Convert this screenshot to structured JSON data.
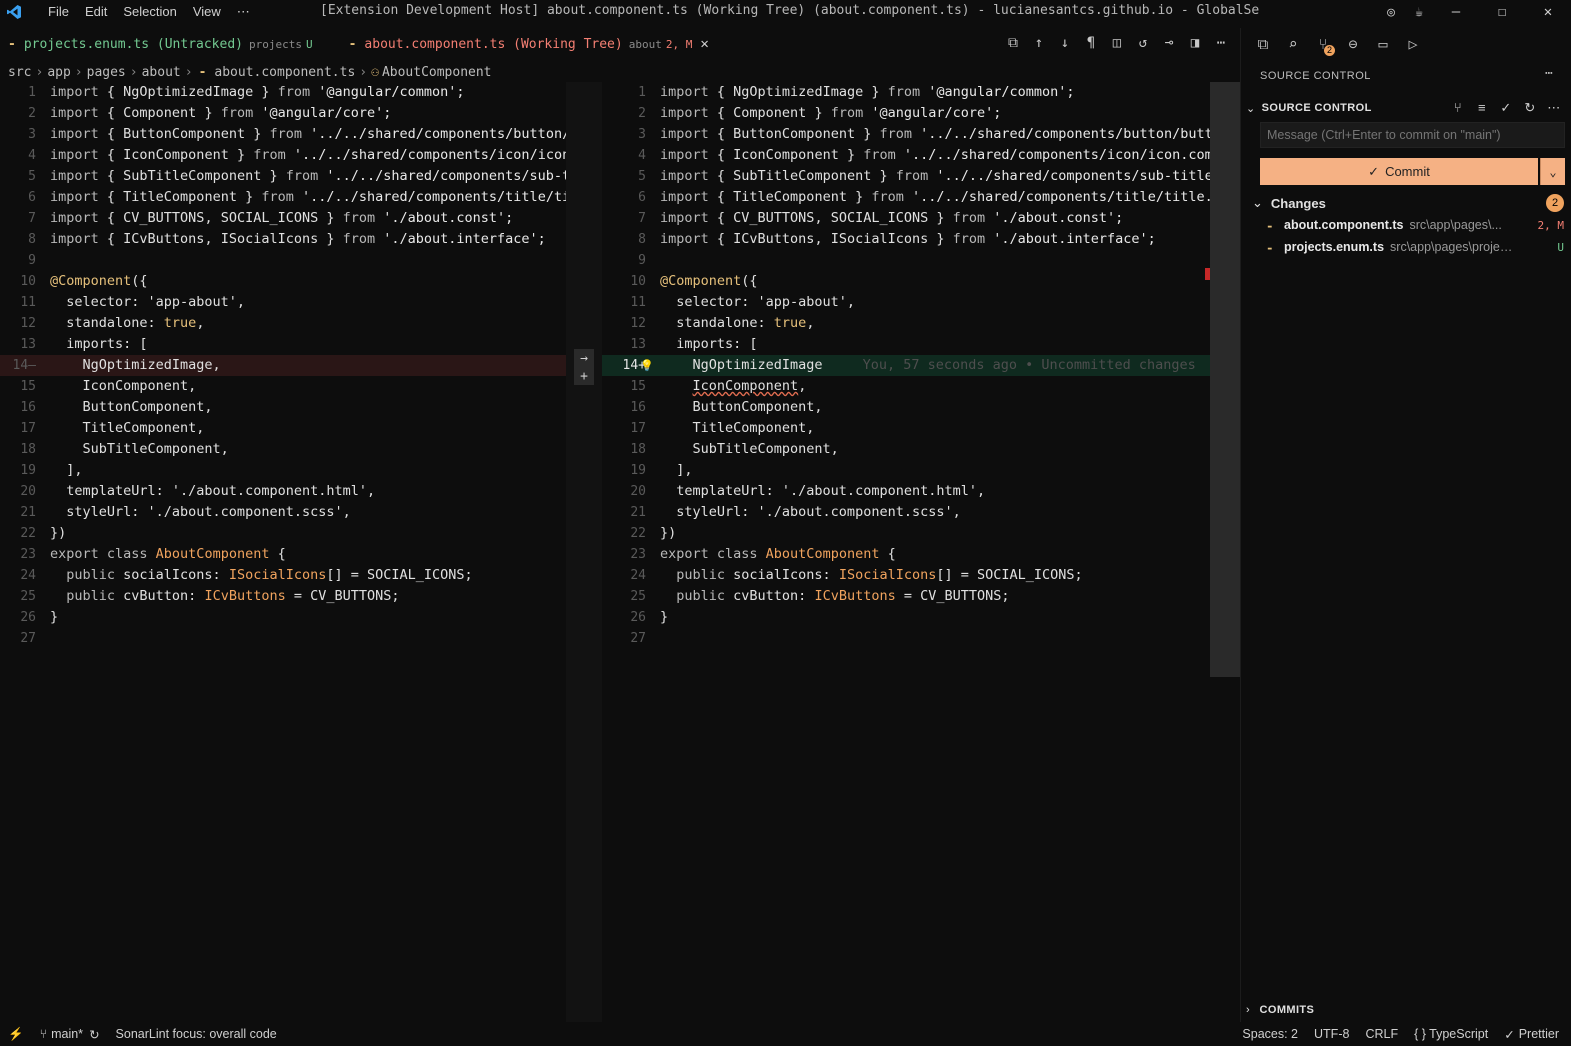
{
  "titlebar": {
    "menu": [
      "File",
      "Edit",
      "Selection",
      "View",
      "⋯"
    ],
    "title": "[Extension Development Host] about.component.ts (Working Tree) (about.component.ts) - lucianesantcs.github.io - GlobalSettings - …"
  },
  "tabs": {
    "projects": {
      "name": "projects.enum.ts (Untracked)",
      "folder": "projects",
      "status": "U"
    },
    "about": {
      "name": "about.component.ts (Working Tree)",
      "folder": "about",
      "status": "2, M"
    }
  },
  "breadcrumb": [
    "src",
    "app",
    "pages",
    "about",
    "about.component.ts",
    "AboutComponent"
  ],
  "editor_left": {
    "lines": [
      {
        "n": "1",
        "segs": [
          [
            "kw",
            "import"
          ],
          [
            "",
            "{ NgOptimizedImage } "
          ],
          [
            "kw",
            "from"
          ],
          [
            "str",
            " '@angular/common';"
          ]
        ]
      },
      {
        "n": "2",
        "segs": [
          [
            "kw",
            "import"
          ],
          [
            "",
            "{ Component } "
          ],
          [
            "kw",
            "from"
          ],
          [
            "str",
            " '@angular/core';"
          ]
        ]
      },
      {
        "n": "3",
        "segs": [
          [
            "kw",
            "import"
          ],
          [
            "",
            "{ ButtonComponent } "
          ],
          [
            "kw",
            "from"
          ],
          [
            "str",
            " '../../shared/components/button/bu"
          ]
        ]
      },
      {
        "n": "4",
        "segs": [
          [
            "kw",
            "import"
          ],
          [
            "",
            "{ IconComponent } "
          ],
          [
            "kw",
            "from"
          ],
          [
            "str",
            " '../../shared/components/icon/icon.c"
          ]
        ]
      },
      {
        "n": "5",
        "segs": [
          [
            "kw",
            "import"
          ],
          [
            "",
            "{ SubTitleComponent } "
          ],
          [
            "kw",
            "from"
          ],
          [
            "str",
            " '../../shared/components/sub-tit"
          ]
        ]
      },
      {
        "n": "6",
        "segs": [
          [
            "kw",
            "import"
          ],
          [
            "",
            "{ TitleComponent } "
          ],
          [
            "kw",
            "from"
          ],
          [
            "str",
            " '../../shared/components/title/titl"
          ]
        ]
      },
      {
        "n": "7",
        "segs": [
          [
            "kw",
            "import"
          ],
          [
            "",
            "{ CV_BUTTONS, SOCIAL_ICONS } "
          ],
          [
            "kw",
            "from"
          ],
          [
            "str",
            " './about.const';"
          ]
        ]
      },
      {
        "n": "8",
        "segs": [
          [
            "kw",
            "import"
          ],
          [
            "",
            "{ ICvButtons, ISocialIcons } "
          ],
          [
            "kw",
            "from"
          ],
          [
            "str",
            " './about.interface';"
          ]
        ]
      },
      {
        "n": "9",
        "segs": []
      },
      {
        "n": "10",
        "segs": [
          [
            "dec",
            "@Component"
          ],
          [
            "",
            "({"
          ]
        ]
      },
      {
        "n": "11",
        "segs": [
          [
            "",
            "  selector: 'app-about',"
          ]
        ]
      },
      {
        "n": "12",
        "segs": [
          [
            "",
            "  standalone: "
          ],
          [
            "bool",
            "true"
          ],
          [
            "",
            ","
          ]
        ]
      },
      {
        "n": "13",
        "segs": [
          [
            "",
            "  imports: ["
          ]
        ]
      },
      {
        "n": "14—",
        "segs": [
          [
            "",
            "    NgOptimizedImage,"
          ]
        ],
        "cls": "line-del"
      },
      {
        "n": "15",
        "segs": [
          [
            "",
            "    IconComponent,"
          ]
        ]
      },
      {
        "n": "16",
        "segs": [
          [
            "",
            "    ButtonComponent,"
          ]
        ]
      },
      {
        "n": "17",
        "segs": [
          [
            "",
            "    TitleComponent,"
          ]
        ]
      },
      {
        "n": "18",
        "segs": [
          [
            "",
            "    SubTitleComponent,"
          ]
        ]
      },
      {
        "n": "19",
        "segs": [
          [
            "",
            "  ],"
          ]
        ]
      },
      {
        "n": "20",
        "segs": [
          [
            "",
            "  templateUrl: './about.component.html',"
          ]
        ]
      },
      {
        "n": "21",
        "segs": [
          [
            "",
            "  styleUrl: './about.component.scss',"
          ]
        ]
      },
      {
        "n": "22",
        "segs": [
          [
            "",
            "})"
          ]
        ]
      },
      {
        "n": "23",
        "segs": [
          [
            "kw",
            "export class "
          ],
          [
            "cls",
            "AboutComponent"
          ],
          [
            "",
            " {"
          ]
        ]
      },
      {
        "n": "24",
        "segs": [
          [
            "kw",
            "  public "
          ],
          [
            "",
            "socialIcons: "
          ],
          [
            "cls",
            "ISocialIcons"
          ],
          [
            "",
            "[] = SOCIAL_ICONS;"
          ]
        ]
      },
      {
        "n": "25",
        "segs": [
          [
            "kw",
            "  public "
          ],
          [
            "",
            "cvButton: "
          ],
          [
            "cls",
            "ICvButtons"
          ],
          [
            "",
            " = CV_BUTTONS;"
          ]
        ]
      },
      {
        "n": "26",
        "segs": [
          [
            "",
            "}"
          ]
        ]
      },
      {
        "n": "27",
        "segs": []
      }
    ]
  },
  "editor_right": {
    "blame": "You, 57 seconds ago • Uncommitted changes",
    "lines": [
      {
        "n": "1",
        "segs": [
          [
            "kw",
            "import"
          ],
          [
            "",
            "{ NgOptimizedImage } "
          ],
          [
            "kw",
            "from"
          ],
          [
            "str",
            " '@angular/common';"
          ]
        ]
      },
      {
        "n": "2",
        "segs": [
          [
            "kw",
            "import"
          ],
          [
            "",
            "{ Component } "
          ],
          [
            "kw",
            "from"
          ],
          [
            "str",
            " '@angular/core';"
          ]
        ]
      },
      {
        "n": "3",
        "segs": [
          [
            "kw",
            "import"
          ],
          [
            "",
            "{ ButtonComponent } "
          ],
          [
            "kw",
            "from"
          ],
          [
            "str",
            " '../../shared/components/button/button."
          ]
        ]
      },
      {
        "n": "4",
        "segs": [
          [
            "kw",
            "import"
          ],
          [
            "",
            "{ IconComponent } "
          ],
          [
            "kw",
            "from"
          ],
          [
            "str",
            " '../../shared/components/icon/icon.compon"
          ]
        ]
      },
      {
        "n": "5",
        "segs": [
          [
            "kw",
            "import"
          ],
          [
            "",
            "{ SubTitleComponent } "
          ],
          [
            "kw",
            "from"
          ],
          [
            "str",
            " '../../shared/components/sub-title/su"
          ]
        ]
      },
      {
        "n": "6",
        "segs": [
          [
            "kw",
            "import"
          ],
          [
            "",
            "{ TitleComponent } "
          ],
          [
            "kw",
            "from"
          ],
          [
            "str",
            " '../../shared/components/title/title.com"
          ]
        ]
      },
      {
        "n": "7",
        "segs": [
          [
            "kw",
            "import"
          ],
          [
            "",
            "{ CV_BUTTONS, SOCIAL_ICONS } "
          ],
          [
            "kw",
            "from"
          ],
          [
            "str",
            " './about.const';"
          ]
        ]
      },
      {
        "n": "8",
        "segs": [
          [
            "kw",
            "import"
          ],
          [
            "",
            "{ ICvButtons, ISocialIcons } "
          ],
          [
            "kw",
            "from"
          ],
          [
            "str",
            " './about.interface';"
          ]
        ]
      },
      {
        "n": "9",
        "segs": []
      },
      {
        "n": "10",
        "segs": [
          [
            "dec",
            "@Component"
          ],
          [
            "",
            "({"
          ]
        ]
      },
      {
        "n": "11",
        "segs": [
          [
            "",
            "  selector: 'app-about',"
          ]
        ]
      },
      {
        "n": "12",
        "segs": [
          [
            "",
            "  standalone: "
          ],
          [
            "bool",
            "true"
          ],
          [
            "",
            ","
          ]
        ]
      },
      {
        "n": "13",
        "segs": [
          [
            "",
            "  imports: ["
          ]
        ]
      },
      {
        "n": "14+",
        "segs": [
          [
            "",
            "    NgOptimizedImage"
          ]
        ],
        "cls": "line-add line-active",
        "blame": true
      },
      {
        "n": "15",
        "segs": [
          [
            "",
            "    "
          ],
          [
            "squiggle",
            "IconComponent"
          ],
          [
            "",
            ","
          ]
        ]
      },
      {
        "n": "16",
        "segs": [
          [
            "",
            "    ButtonComponent,"
          ]
        ]
      },
      {
        "n": "17",
        "segs": [
          [
            "",
            "    TitleComponent,"
          ]
        ]
      },
      {
        "n": "18",
        "segs": [
          [
            "",
            "    SubTitleComponent,"
          ]
        ]
      },
      {
        "n": "19",
        "segs": [
          [
            "",
            "  ],"
          ]
        ]
      },
      {
        "n": "20",
        "segs": [
          [
            "",
            "  templateUrl: './about.component.html',"
          ]
        ]
      },
      {
        "n": "21",
        "segs": [
          [
            "",
            "  styleUrl: './about.component.scss',"
          ]
        ]
      },
      {
        "n": "22",
        "segs": [
          [
            "",
            "})"
          ]
        ]
      },
      {
        "n": "23",
        "segs": [
          [
            "kw",
            "export class "
          ],
          [
            "cls",
            "AboutComponent"
          ],
          [
            "",
            " {"
          ]
        ]
      },
      {
        "n": "24",
        "segs": [
          [
            "kw",
            "  public "
          ],
          [
            "",
            "socialIcons: "
          ],
          [
            "cls",
            "ISocialIcons"
          ],
          [
            "",
            "[] = SOCIAL_ICONS;"
          ]
        ]
      },
      {
        "n": "25",
        "segs": [
          [
            "kw",
            "  public "
          ],
          [
            "",
            "cvButton: "
          ],
          [
            "cls",
            "ICvButtons"
          ],
          [
            "",
            " = CV_BUTTONS;"
          ]
        ]
      },
      {
        "n": "26",
        "segs": [
          [
            "",
            "}"
          ]
        ]
      },
      {
        "n": "27",
        "segs": []
      }
    ]
  },
  "scm": {
    "header": "SOURCE CONTROL",
    "section": "SOURCE CONTROL",
    "activity_badge": "2",
    "message_placeholder": "Message (Ctrl+Enter to commit on \"main\")",
    "commit_label": "Commit",
    "changes_label": "Changes",
    "changes_count": "2",
    "changes": [
      {
        "name": "about.component.ts",
        "path": "src\\app\\pages\\...",
        "status": "2, M",
        "color": "#f47f73"
      },
      {
        "name": "projects.enum.ts",
        "path": "src\\app\\pages\\proje…",
        "status": "U",
        "color": "#73c991"
      }
    ],
    "commits_label": "COMMITS"
  },
  "statusbar": {
    "branch": "main*",
    "sonar": "SonarLint focus: overall code",
    "spaces": "Spaces: 2",
    "encoding": "UTF-8",
    "eol": "CRLF",
    "language": "{ } TypeScript",
    "prettier": "Prettier"
  }
}
